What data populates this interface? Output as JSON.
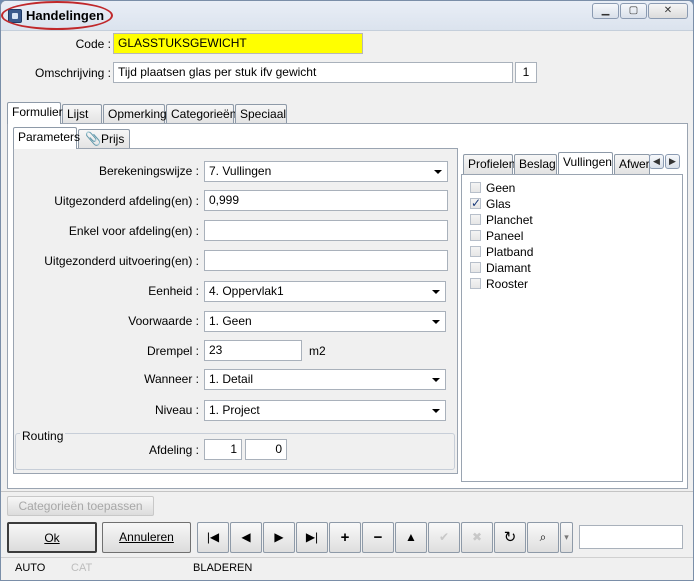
{
  "window": {
    "title": "Handelingen",
    "controls": [
      "minimize-icon",
      "maximize-icon",
      "close-icon"
    ]
  },
  "header": {
    "code_label": "Code :",
    "code_value": "GLASSTUKSGEWICHT",
    "desc_label": "Omschrijving :",
    "desc_value": "Tijd plaatsen glas per stuk ifv gewicht",
    "desc_count": "1"
  },
  "main_tabs": [
    {
      "label": "Formulier",
      "active": true
    },
    {
      "label": "Lijst"
    },
    {
      "label": "Opmerking"
    },
    {
      "label": "Categorieën"
    },
    {
      "label": "Speciaal"
    }
  ],
  "sub_tabs": [
    {
      "label": "Parameters",
      "active": true
    },
    {
      "label": "Prijs",
      "icon": "paperclip-icon"
    }
  ],
  "form": {
    "berekeningswijze": {
      "label": "Berekeningswijze :",
      "value": "7. Vullingen"
    },
    "uitgezonderd_afdeling": {
      "label": "Uitgezonderd afdeling(en) :",
      "value": "0,999"
    },
    "enkel_afdeling": {
      "label": "Enkel voor afdeling(en) :",
      "value": ""
    },
    "uitgezonderd_uitvoering": {
      "label": "Uitgezonderd uitvoering(en) :",
      "value": ""
    },
    "eenheid": {
      "label": "Eenheid :",
      "value": "4. Oppervlak1"
    },
    "voorwaarde": {
      "label": "Voorwaarde :",
      "value": "1. Geen"
    },
    "drempel": {
      "label": "Drempel :",
      "value": "23",
      "unit": "m2"
    },
    "wanneer": {
      "label": "Wanneer :",
      "value": "1. Detail"
    },
    "niveau": {
      "label": "Niveau :",
      "value": "1. Project"
    }
  },
  "routing": {
    "group_label": "Routing",
    "afdeling_label": "Afdeling :",
    "value1": "1",
    "value2": "0"
  },
  "right_tabs": [
    {
      "label": "Profielen"
    },
    {
      "label": "Beslag"
    },
    {
      "label": "Vullingen",
      "active": true
    },
    {
      "label": "Afwerl"
    }
  ],
  "vullingen": [
    {
      "label": "Geen",
      "checked": false
    },
    {
      "label": "Glas",
      "checked": true
    },
    {
      "label": "Planchet",
      "checked": false
    },
    {
      "label": "Paneel",
      "checked": false
    },
    {
      "label": "Platband",
      "checked": false
    },
    {
      "label": "Diamant",
      "checked": false
    },
    {
      "label": "Rooster",
      "checked": false
    }
  ],
  "categorieen_button": "Categorieën toepassen",
  "buttons": {
    "ok": "Ok",
    "annuleren": "Annuleren"
  },
  "nav_icons": [
    "first-record-icon",
    "previous-record-icon",
    "next-record-icon",
    "last-record-icon",
    "add-icon",
    "delete-icon",
    "up-icon",
    "confirm-icon",
    "cancel-icon",
    "refresh-icon",
    "binoculars-icon"
  ],
  "status": {
    "mode1": "AUTO",
    "mode2": "CAT",
    "mode3": "BLADEREN"
  }
}
